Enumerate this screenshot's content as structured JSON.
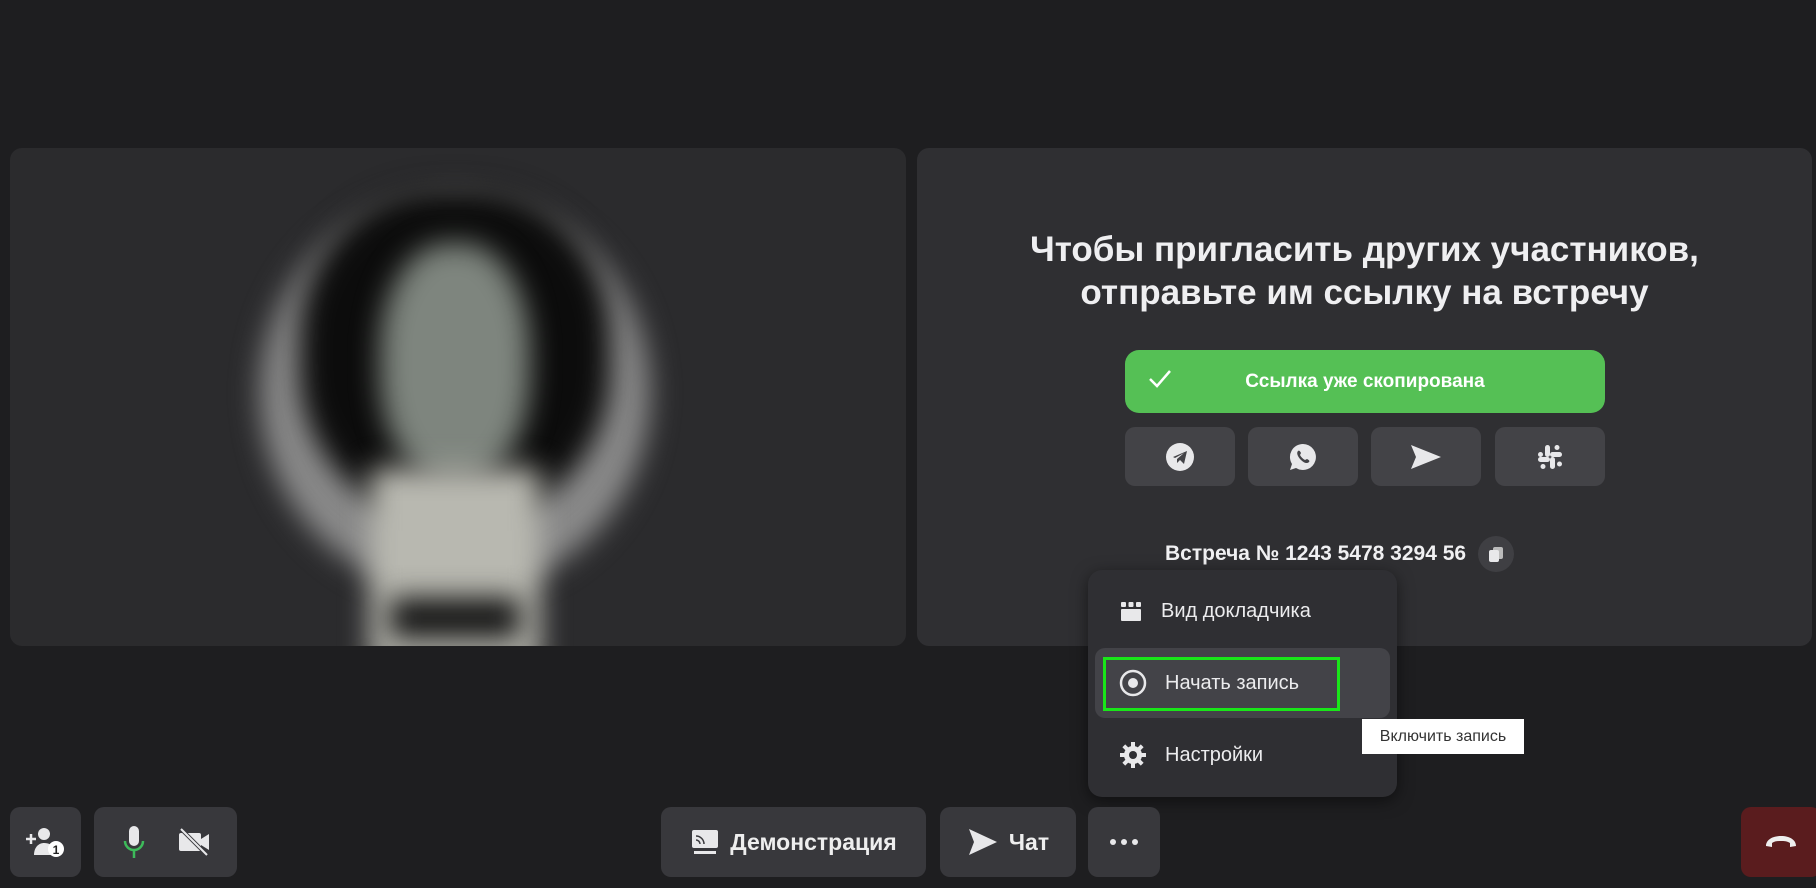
{
  "invite": {
    "heading_line1": "Чтобы пригласить других участников,",
    "heading_line2": "отправьте им ссылку на встречу",
    "copied_button": "Ссылка уже скопирована",
    "share_buttons": [
      "telegram-icon",
      "whatsapp-icon",
      "send-icon",
      "slack-icon"
    ],
    "meeting_number": "Встреча № 1243 5478 3294 56"
  },
  "menu": {
    "items": [
      {
        "label": "Вид докладчика",
        "icon": "speaker-view-icon"
      },
      {
        "label": "Начать запись",
        "icon": "record-icon"
      },
      {
        "label": "Настройки",
        "icon": "gear-icon"
      }
    ],
    "tooltip": "Включить запись"
  },
  "toolbar": {
    "participants_count": "1",
    "demo_label": "Демонстрация",
    "chat_label": "Чат"
  },
  "colors": {
    "accent_green": "#55c055",
    "hangup": "#5a1c1e",
    "mic_active": "#3dbb5a"
  }
}
